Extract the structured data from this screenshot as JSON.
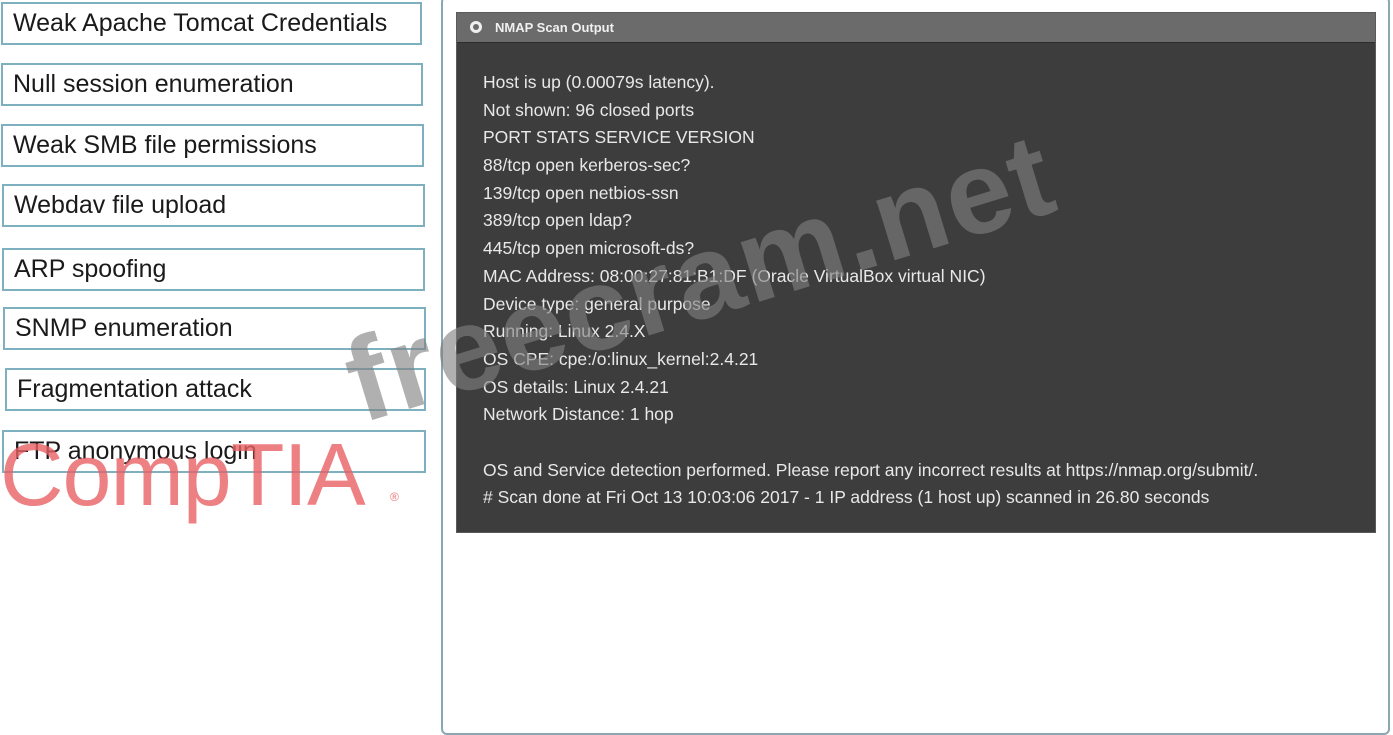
{
  "answers": [
    "Weak Apache Tomcat Credentials",
    "Null session enumeration",
    "Weak SMB file permissions",
    "Webdav file upload",
    "ARP spoofing",
    "SNMP enumeration",
    "Fragmentation attack",
    "FTP anonymous login"
  ],
  "terminal": {
    "title": "NMAP Scan Output",
    "lines": [
      "Host is up (0.00079s latency).",
      "Not shown: 96 closed ports",
      "PORT STATS SERVICE VERSION",
      "88/tcp open kerberos-sec?",
      "139/tcp open netbios-ssn",
      "389/tcp open ldap?",
      "445/tcp open microsoft-ds?",
      "MAC Address: 08:00:27:81:B1:DF (Oracle VirtualBox virtual NIC)",
      "Device type: general purpose",
      "Running: Linux 2.4.X",
      "OS CPE: cpe:/o:linux_kernel:2.4.21",
      "OS details: Linux 2.4.21",
      "Network Distance: 1 hop",
      "",
      "OS and Service detection performed. Please report any incorrect results at https://nmap.org/submit/.",
      "# Scan done at Fri Oct 13 10:03:06 2017 - 1 IP address (1 host up) scanned in 26.80 seconds"
    ]
  },
  "watermark": {
    "text": "freecram.net"
  },
  "logo": {
    "text": "CompTIA",
    "registered": "®"
  },
  "colors": {
    "answer_border": "#7fb0bf",
    "terminal_bg": "#3d3d3d",
    "titlebar_bg": "#6b6b6b",
    "logo_red": "#e86064"
  }
}
